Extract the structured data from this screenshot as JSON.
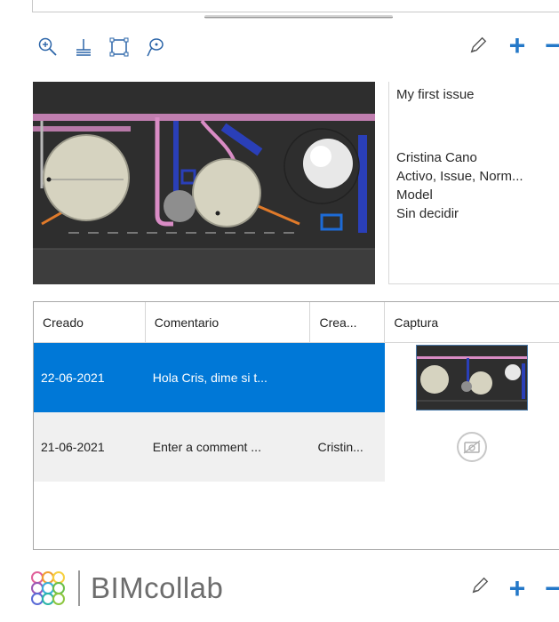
{
  "toolbar": {
    "left_icons": [
      "zoom-in-icon",
      "clip-plane-icon",
      "section-box-icon",
      "lasso-select-icon"
    ],
    "right_icons": [
      "pencil-icon",
      "plus-icon",
      "minus-icon"
    ]
  },
  "issue": {
    "title": "My first issue",
    "assigned_to": "Cristina Cano",
    "labels": "Activo, Issue, Norm...",
    "area": "Model",
    "milestone": "Sin decidir"
  },
  "comments_table": {
    "columns": [
      "Creado",
      "Comentario",
      "Crea...",
      "Captura"
    ],
    "rows": [
      {
        "created": "22-06-2021",
        "comment": "Hola Cris, dime si t...",
        "creator": "",
        "capture": "snapshot",
        "selected": true
      },
      {
        "created": "21-06-2021",
        "comment": "Enter a comment ...",
        "creator": "Cristin...",
        "capture": "no-image",
        "selected": false
      }
    ]
  },
  "footer": {
    "brand": "BIMcollab",
    "icons": [
      "pencil-icon",
      "plus-icon",
      "minus-icon"
    ]
  },
  "colors": {
    "accent": "#2478c8",
    "selection": "#0078d7",
    "viewport_bg": "#2e2e2e",
    "pipe_pink": "#d98cc5",
    "pipe_blue": "#2a3fb8",
    "pipe_orange": "#e07a2a"
  }
}
